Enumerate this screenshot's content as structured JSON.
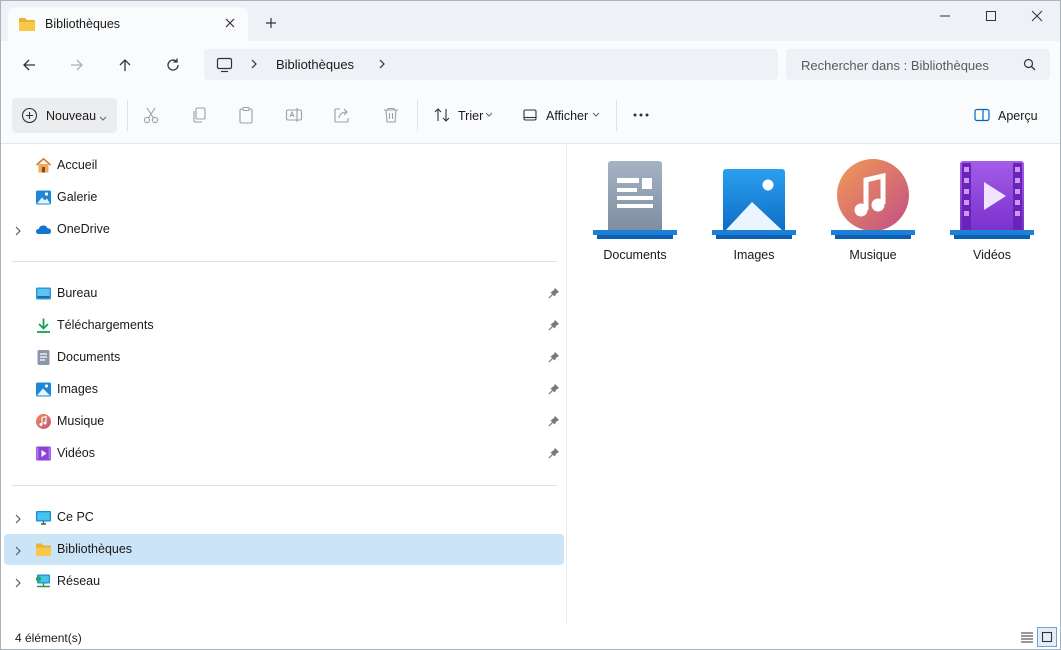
{
  "window": {
    "tab_title": "Bibliothèques"
  },
  "address": {
    "crumbs": [
      "Bibliothèques"
    ],
    "search_placeholder": "Rechercher dans : Bibliothèques"
  },
  "toolbar": {
    "new_label": "Nouveau",
    "sort_label": "Trier",
    "view_label": "Afficher",
    "preview_label": "Aperçu"
  },
  "nav": {
    "top": [
      {
        "label": "Accueil",
        "icon": "home-icon"
      },
      {
        "label": "Galerie",
        "icon": "gallery-icon"
      },
      {
        "label": "OneDrive",
        "icon": "onedrive-icon"
      }
    ],
    "pinned": [
      {
        "label": "Bureau",
        "icon": "desktop-icon"
      },
      {
        "label": "Téléchargements",
        "icon": "download-icon"
      },
      {
        "label": "Documents",
        "icon": "documents-icon"
      },
      {
        "label": "Images",
        "icon": "pictures-icon"
      },
      {
        "label": "Musique",
        "icon": "music-icon"
      },
      {
        "label": "Vidéos",
        "icon": "videos-icon"
      }
    ],
    "bottom": [
      {
        "label": "Ce PC",
        "icon": "pc-icon"
      },
      {
        "label": "Bibliothèques",
        "icon": "folder-icon",
        "selected": true
      },
      {
        "label": "Réseau",
        "icon": "network-icon"
      }
    ]
  },
  "content": {
    "items": [
      {
        "label": "Documents",
        "icon": "documents-library-icon"
      },
      {
        "label": "Images",
        "icon": "pictures-library-icon"
      },
      {
        "label": "Musique",
        "icon": "music-library-icon"
      },
      {
        "label": "Vidéos",
        "icon": "videos-library-icon"
      }
    ]
  },
  "status": {
    "item_count": "4 élément(s)"
  },
  "colors": {
    "accent": "#0067c0",
    "selection": "#cce4f7",
    "titlebar": "#eef2f7"
  }
}
